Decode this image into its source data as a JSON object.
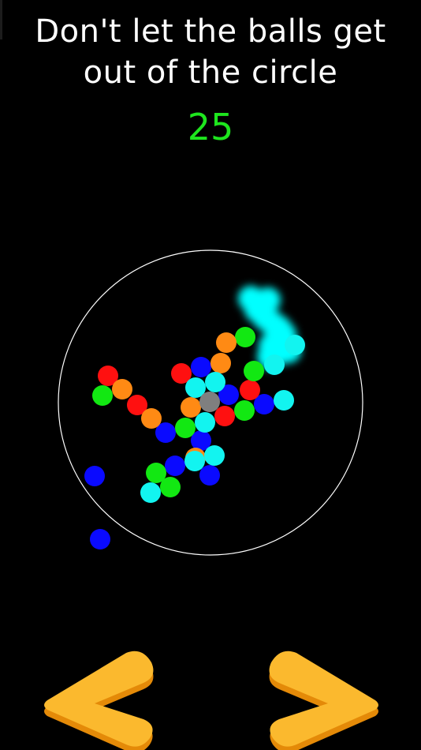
{
  "header": {
    "instruction_line1": "Don't let the balls get",
    "instruction_line2": "out of the circle",
    "score": "25"
  },
  "colors": {
    "background": "#000000",
    "text": "#ffffff",
    "score": "#1ee61e",
    "circle_outline": "#ffffff",
    "glow_trail": "#00ffff",
    "button_face": "#fbb92e",
    "button_side": "#e48a08"
  },
  "balls": [
    {
      "color": "blue"
    },
    {
      "color": "blue"
    },
    {
      "color": "blue"
    },
    {
      "color": "blue"
    },
    {
      "color": "blue"
    },
    {
      "color": "blue"
    },
    {
      "color": "blue"
    },
    {
      "color": "blue"
    },
    {
      "color": "blue"
    },
    {
      "color": "red"
    },
    {
      "color": "red"
    },
    {
      "color": "red"
    },
    {
      "color": "red"
    },
    {
      "color": "red"
    },
    {
      "color": "green"
    },
    {
      "color": "green"
    },
    {
      "color": "green"
    },
    {
      "color": "green"
    },
    {
      "color": "green"
    },
    {
      "color": "green"
    },
    {
      "color": "green"
    },
    {
      "color": "orange"
    },
    {
      "color": "orange"
    },
    {
      "color": "orange"
    },
    {
      "color": "orange"
    },
    {
      "color": "orange"
    },
    {
      "color": "orange"
    },
    {
      "color": "cyan"
    },
    {
      "color": "cyan"
    },
    {
      "color": "cyan"
    },
    {
      "color": "cyan"
    },
    {
      "color": "cyan"
    },
    {
      "color": "cyan"
    },
    {
      "color": "cyan"
    },
    {
      "color": "cyan"
    },
    {
      "color": "cyan"
    },
    {
      "color": "gray"
    }
  ],
  "ball_palette": {
    "blue": "#0a0aff",
    "red": "#ff1010",
    "green": "#12e812",
    "orange": "#ff8a14",
    "cyan": "#12f4f0",
    "gray": "#7f7f7f"
  },
  "controls": {
    "left_icon": "chevron-left-icon",
    "right_icon": "chevron-right-icon"
  }
}
